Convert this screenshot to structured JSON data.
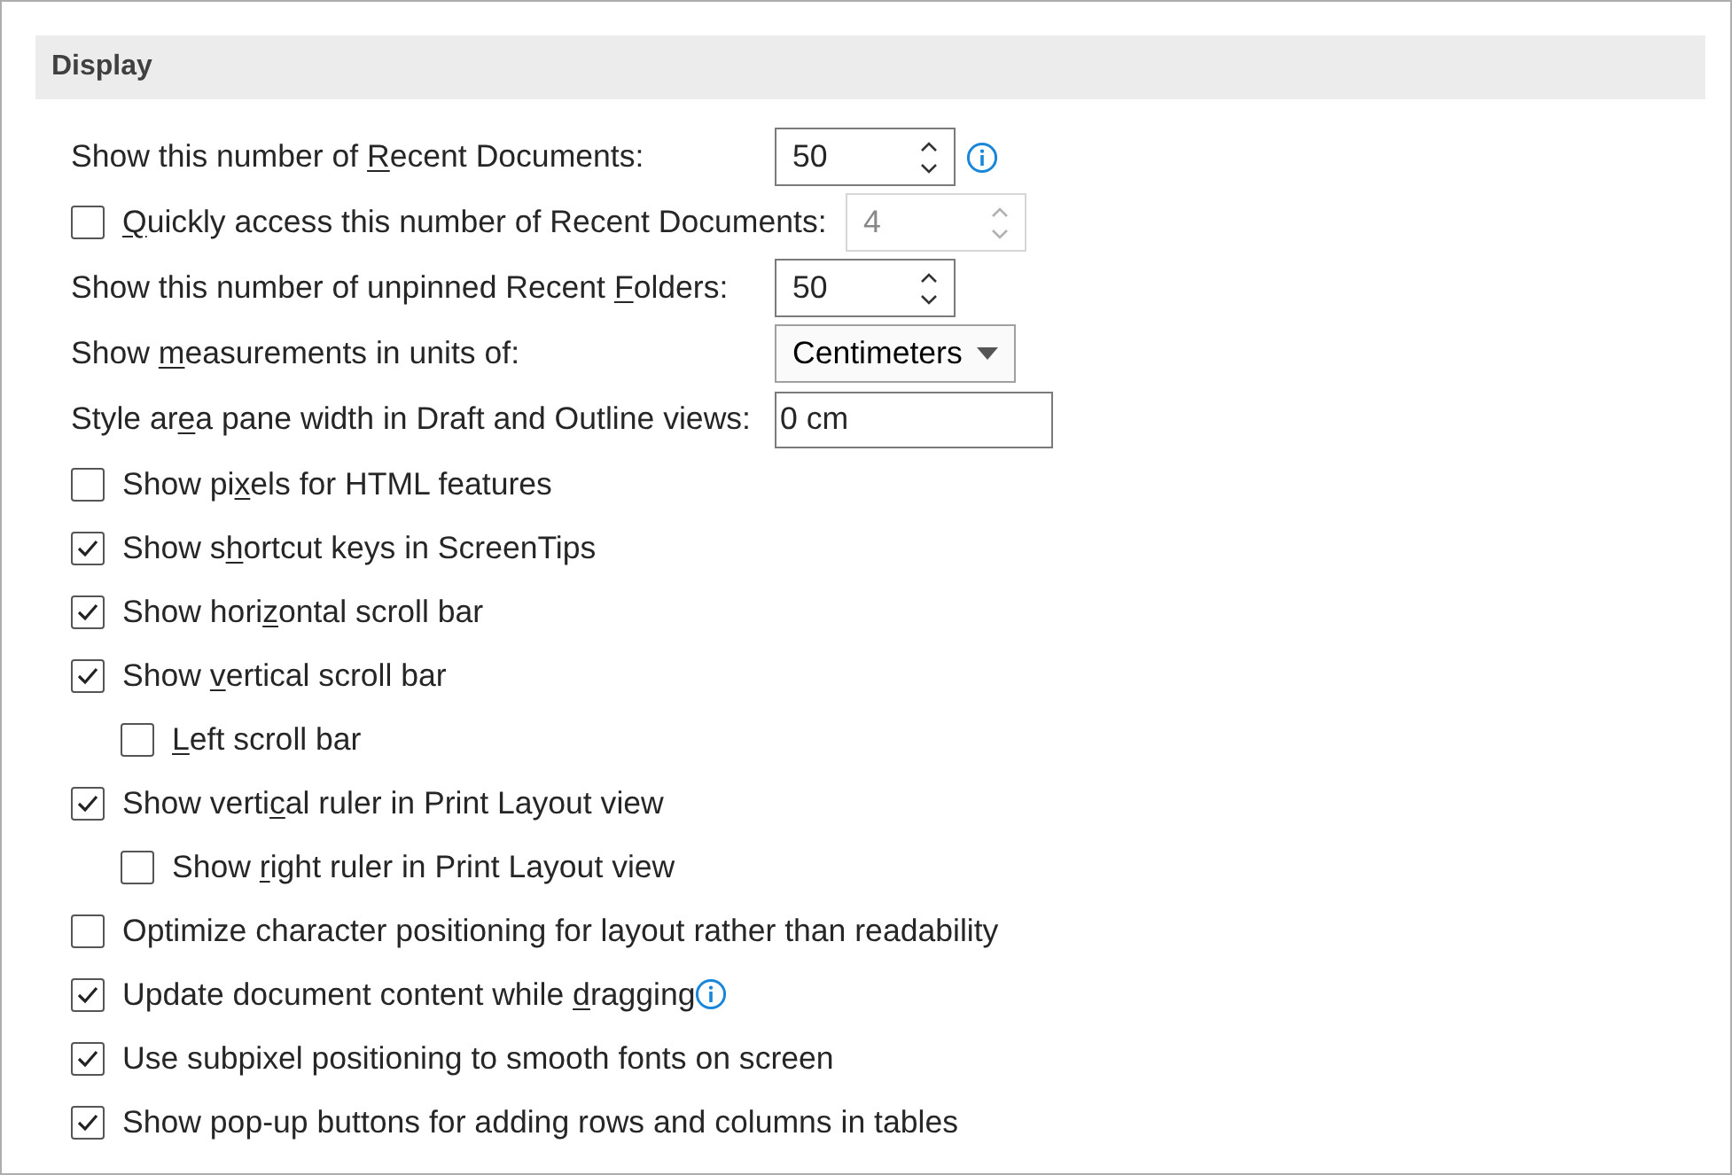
{
  "section": {
    "title": "Display"
  },
  "settings": [
    {
      "kind": "spin",
      "label": {
        "pre": "Show this number of ",
        "key": "R",
        "post": "ecent Documents:"
      },
      "value": "50",
      "disabled": false,
      "info": true
    },
    {
      "kind": "check_spin",
      "checked": false,
      "label": {
        "key": "Q",
        "post": "uickly access this number of Recent Documents:"
      },
      "value": "4",
      "disabled": true,
      "info": false
    },
    {
      "kind": "spin",
      "label": {
        "pre": "Show this number of unpinned Recent ",
        "key": "F",
        "post": "olders:"
      },
      "value": "50",
      "disabled": false,
      "info": false
    },
    {
      "kind": "dropdown",
      "label": {
        "pre": "Show ",
        "key": "m",
        "post": "easurements in units of:"
      },
      "value": "Centimeters",
      "info": false
    },
    {
      "kind": "text",
      "label": {
        "pre": "Style ar",
        "key": "e",
        "post": "a pane width in Draft and Outline views:"
      },
      "value": "0 cm",
      "info": false
    },
    {
      "kind": "check",
      "checked": false,
      "label": {
        "pre": "Show pi",
        "key": "x",
        "post": "els for HTML features"
      },
      "info": false
    },
    {
      "kind": "check",
      "checked": true,
      "label": {
        "pre": "Show s",
        "key": "h",
        "post": "ortcut keys in ScreenTips"
      },
      "info": false
    },
    {
      "kind": "check",
      "checked": true,
      "label": {
        "pre": "Show hori",
        "key": "z",
        "post": "ontal scroll bar"
      },
      "info": false
    },
    {
      "kind": "check",
      "checked": true,
      "label": {
        "pre": "Show ",
        "key": "v",
        "post": "ertical scroll bar"
      },
      "info": false,
      "children": [
        {
          "kind": "check",
          "checked": false,
          "label": {
            "key": "L",
            "post": "eft scroll bar"
          },
          "info": false
        }
      ]
    },
    {
      "kind": "check",
      "checked": true,
      "label": {
        "pre": "Show verti",
        "key": "c",
        "post": "al ruler in Print Layout view"
      },
      "info": false,
      "children": [
        {
          "kind": "check",
          "checked": false,
          "label": {
            "pre": "Show ",
            "key": "r",
            "post": "ight ruler in Print Layout view"
          },
          "info": false
        }
      ]
    },
    {
      "kind": "check",
      "checked": false,
      "label": {
        "pre": "Optimize character positioning for layout rather than readability"
      },
      "info": false
    },
    {
      "kind": "check",
      "checked": true,
      "label": {
        "pre": "Update document content while ",
        "key": "d",
        "post": "ragging"
      },
      "info": true
    },
    {
      "kind": "check",
      "checked": true,
      "label": {
        "pre": "Use subpixel positioning to smooth fonts on screen"
      },
      "info": false
    },
    {
      "kind": "check",
      "checked": true,
      "label": {
        "pre": "Show pop-up buttons for adding rows and columns in tables"
      },
      "info": false
    }
  ]
}
